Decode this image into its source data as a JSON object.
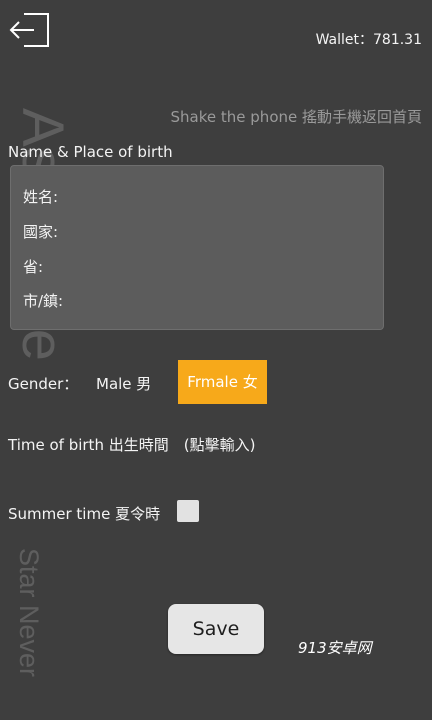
{
  "header": {
    "exit_icon": "exit-arrow-icon",
    "wallet_text": "Wallet：781.31"
  },
  "hint_text": "Shake the phone 搖動手機返回首頁",
  "watermark": {
    "main": "Astrolabe",
    "sub": "Star Never"
  },
  "form": {
    "name_label": "Name & Place of birth",
    "fields": [
      "姓名:",
      "國家:",
      "省:",
      "市/鎮:"
    ],
    "gender_label": "Gender：",
    "gender_male": "Male 男",
    "gender_female": "Frmale 女",
    "time_of_birth": "Time of birth 出生時間　(點擊輸入)",
    "summer_time_label": "Summer time 夏令時",
    "summer_time_checked": false,
    "save_label": "Save"
  },
  "brand_mark": "913安卓网",
  "colors": {
    "background": "#3e3e3e",
    "accent": "#f7a91a",
    "panel": "#5c5c5c"
  }
}
